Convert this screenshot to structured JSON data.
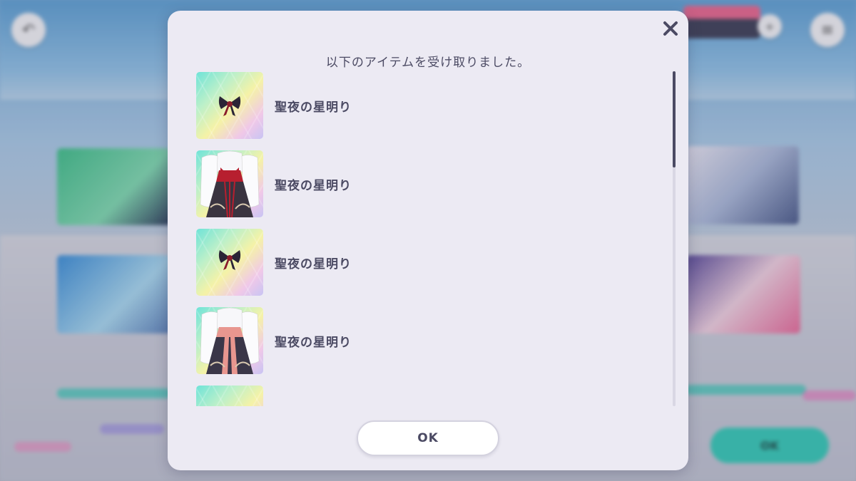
{
  "background": {
    "ok_label": "OK"
  },
  "dialog": {
    "title": "以下のアイテムを受け取りました。",
    "close_icon": "close-icon",
    "ok_label": "OK",
    "items": [
      {
        "name": "聖夜の星明り",
        "icon": "ribbon-bow-icon"
      },
      {
        "name": "聖夜の星明り",
        "icon": "outfit-white-red-icon"
      },
      {
        "name": "聖夜の星明り",
        "icon": "ribbon-bow-icon"
      },
      {
        "name": "聖夜の星明り",
        "icon": "outfit-white-pink-icon"
      },
      {
        "name": "",
        "icon": "item-thumbnail"
      }
    ]
  },
  "colors": {
    "dialog_bg": "#eceaf3",
    "text": "#4b4a63",
    "accent_teal": "#35c9b7",
    "accent_pink": "#e8668e"
  }
}
